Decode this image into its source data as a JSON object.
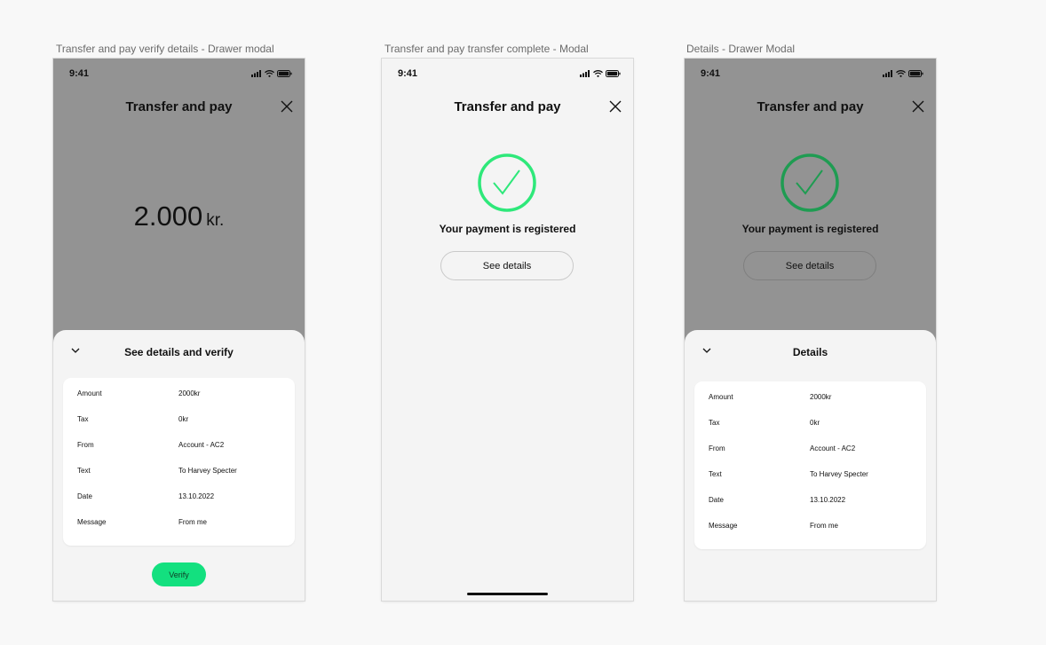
{
  "frames": {
    "verify": {
      "label": "Transfer and pay verify details - Drawer modal",
      "time": "9:41",
      "title": "Transfer and pay",
      "amount": "2.000",
      "unit": "kr.",
      "drawer_title": "See details and verify",
      "verify_label": "Verify",
      "rows": [
        {
          "key": "Amount",
          "value": "2000kr"
        },
        {
          "key": "Tax",
          "value": "0kr"
        },
        {
          "key": "From",
          "value": "Account - AC2"
        },
        {
          "key": "Text",
          "value": "To Harvey Specter"
        },
        {
          "key": "Date",
          "value": "13.10.2022"
        },
        {
          "key": "Message",
          "value": "From me"
        }
      ]
    },
    "complete": {
      "label": "Transfer and pay transfer complete - Modal",
      "time": "9:41",
      "title": "Transfer and pay",
      "message": "Your payment is registered",
      "button_label": "See details"
    },
    "details": {
      "label": "Details - Drawer Modal",
      "time": "9:41",
      "title": "Transfer and pay",
      "message": "Your payment is registered",
      "button_label": "See details",
      "drawer_title": "Details",
      "rows": [
        {
          "key": "Amount",
          "value": "2000kr"
        },
        {
          "key": "Tax",
          "value": "0kr"
        },
        {
          "key": "From",
          "value": "Account - AC2"
        },
        {
          "key": "Text",
          "value": "To Harvey Specter"
        },
        {
          "key": "Date",
          "value": "13.10.2022"
        },
        {
          "key": "Message",
          "value": "From me"
        }
      ]
    }
  },
  "icons": {
    "close": "close-icon",
    "check": "checkmark-circle-icon",
    "chevron": "chevron-down-icon",
    "signal": "cellular-signal-icon",
    "wifi": "wifi-icon",
    "battery": "battery-icon"
  },
  "colors": {
    "success": "#2ee87a",
    "success_dimmed": "#1f9c52",
    "verify_button": "#13e07f",
    "overlay": "#939393"
  }
}
